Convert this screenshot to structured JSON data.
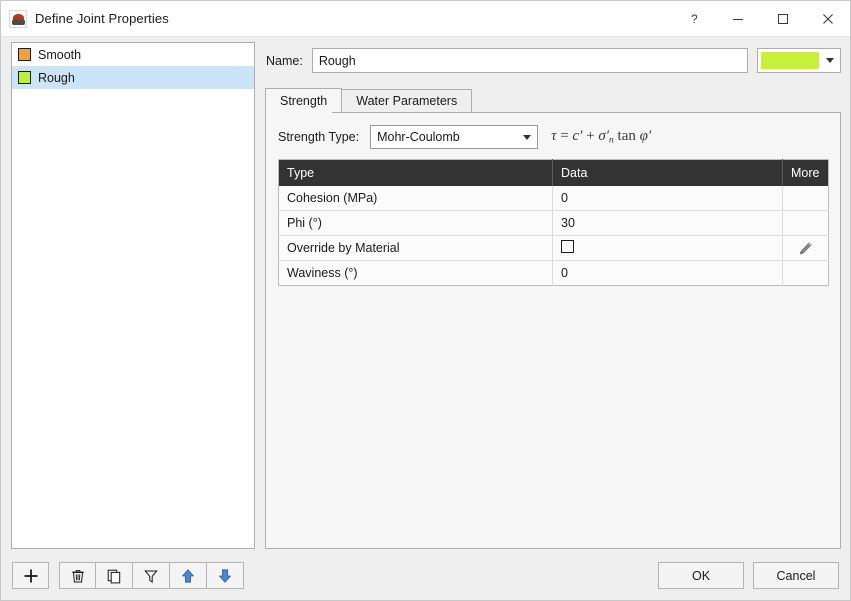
{
  "window": {
    "title": "Define Joint Properties",
    "icon": "app-icon",
    "controls": {
      "help": "?",
      "minimize": "—",
      "maximize": "□",
      "close": "✕"
    }
  },
  "list": {
    "items": [
      {
        "label": "Smooth",
        "color": "#F0A040",
        "selected": false
      },
      {
        "label": "Rough",
        "color": "#C0EE40",
        "selected": true
      }
    ]
  },
  "name_row": {
    "label": "Name:",
    "value": "Rough",
    "placeholder": "",
    "color_value": "#C6F03C"
  },
  "tabs": [
    {
      "label": "Strength",
      "active": true
    },
    {
      "label": "Water Parameters",
      "active": false
    }
  ],
  "strength": {
    "type_label": "Strength Type:",
    "type_value": "Mohr-Coulomb",
    "formula": {
      "tau": "τ",
      "equals": "=",
      "c_prime": "c′",
      "plus": "+",
      "sigma_prime": "σ′",
      "sigma_sub": "n",
      "tan": "tan",
      "phi_prime": "φ′"
    },
    "table": {
      "headers": [
        "Type",
        "Data",
        "More"
      ],
      "rows": [
        {
          "type": "Cohesion (MPa)",
          "data": "0",
          "more": ""
        },
        {
          "type": "Phi (°)",
          "data": "30",
          "more": ""
        },
        {
          "type": "Override by Material",
          "data": "",
          "more": "pencil-icon",
          "checkbox": false
        },
        {
          "type": "Waviness (°)",
          "data": "0",
          "more": ""
        }
      ]
    }
  },
  "toolbar": {
    "add": "add-icon",
    "delete": "trash-icon",
    "duplicate": "copy-icon",
    "filter": "funnel-icon",
    "move_up": "arrow-up-icon",
    "move_down": "arrow-down-icon"
  },
  "buttons": {
    "ok": "OK",
    "cancel": "Cancel"
  }
}
